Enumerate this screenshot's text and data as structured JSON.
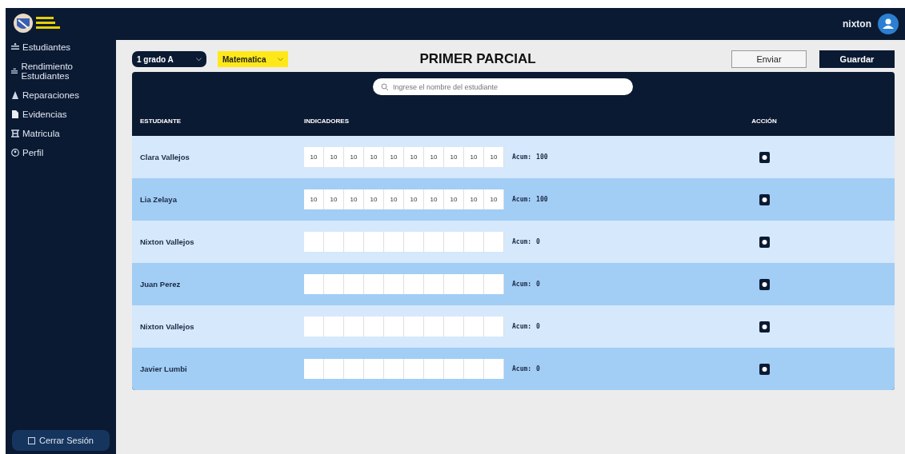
{
  "header": {
    "user": "nixton"
  },
  "sidebar": {
    "items": [
      {
        "label": "Estudiantes",
        "kind": "users"
      },
      {
        "label": "Rendimiento Estudiantes",
        "kind": "chart"
      },
      {
        "label": "Reparaciones",
        "kind": "tool"
      },
      {
        "label": "Evidencias",
        "kind": "file"
      },
      {
        "label": "Matricula",
        "kind": "table"
      },
      {
        "label": "Perfil",
        "kind": "person"
      }
    ],
    "logout": "Cerrar Sesión"
  },
  "toolbar": {
    "grade": "1 grado A",
    "subject": "Matematica",
    "title": "PRIMER PARCIAL",
    "buttons": [
      {
        "label": "Enviar",
        "kind": "outline"
      },
      {
        "label": "Guardar",
        "kind": "dark"
      }
    ]
  },
  "search": {
    "placeholder": "Ingrese el nombre del estudiante"
  },
  "table": {
    "columns": [
      "ESTUDIANTE",
      "INDICADORES",
      "ACCIÓN"
    ],
    "rows": [
      {
        "name": "Clara Vallejos",
        "scores": [
          "10",
          "10",
          "10",
          "10",
          "10",
          "10",
          "10",
          "10",
          "10",
          "10"
        ],
        "total_label": "Acum:",
        "total": "100"
      },
      {
        "name": "Lia Zelaya",
        "scores": [
          "10",
          "10",
          "10",
          "10",
          "10",
          "10",
          "10",
          "10",
          "10",
          "10"
        ],
        "total_label": "Acum:",
        "total": "100"
      },
      {
        "name": "Nixton Vallejos",
        "scores": [],
        "total_label": "Acum:",
        "total": "0"
      },
      {
        "name": "Juan Perez",
        "scores": [],
        "total_label": "Acum:",
        "total": "0"
      },
      {
        "name": "Nixton Vallejos",
        "scores": [],
        "total_label": "Acum:",
        "total": "0"
      },
      {
        "name": "Javier Lumbi",
        "scores": [],
        "total_label": "Acum:",
        "total": "0"
      }
    ]
  }
}
